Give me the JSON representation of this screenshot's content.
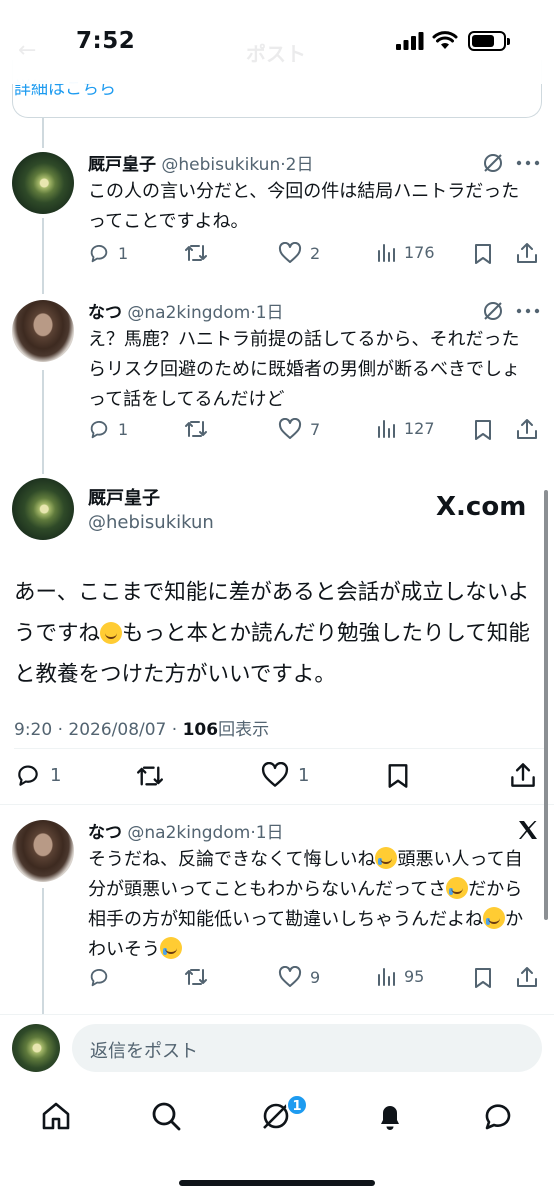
{
  "status": {
    "time": "7:52"
  },
  "header": {
    "title": "ポスト",
    "back": "←"
  },
  "prev_card": {
    "link": "詳細はこちら"
  },
  "replies": [
    {
      "name": "厩戸皇子",
      "handle": "@hebisukikun",
      "age": "2日",
      "text": "この人の言い分だと、今回の件は結局ハニトラだったってことですよね。",
      "replies": "1",
      "reposts": "",
      "likes": "2",
      "views": "176"
    },
    {
      "name": "なつ",
      "handle": "@na2kingdom",
      "age": "1日",
      "text": "え？馬鹿？ハニトラ前提の話してるから、それだったらリスク回避のために既婚者の男側が断るべきでしょって話をしてるんだけど",
      "replies": "1",
      "reposts": "",
      "likes": "7",
      "views": "127"
    }
  ],
  "main": {
    "name": "厩戸皇子",
    "handle": "@hebisukikun",
    "source": "X.com",
    "text_a": "あー、ここまで知能に差があると会話が成立しないようですね",
    "text_b": "もっと本とか読んだり勉強したりして知能と教養をつけた方がいいですよ。",
    "timestamp": "9:20 · 2026/08/07 · ",
    "views_count": "106",
    "views_label": "回表示",
    "replies": "1",
    "likes": "1"
  },
  "reply3": {
    "name": "なつ",
    "handle": "@na2kingdom",
    "age": "1日",
    "text_a": "そうだね、反論できなくて悔しいね",
    "text_b": "頭悪い人って自分が頭悪いってこともわからないんだってさ",
    "text_c": "だから相手の方が知能低いって勘違いしちゃうんだよね",
    "text_d": "かわいそう",
    "likes": "9",
    "views": "95"
  },
  "composer": {
    "placeholder": "返信をポスト"
  },
  "tabs": {
    "notif_badge": "1"
  },
  "colors": {
    "accent": "#1d9bf0",
    "text": "#0f1419",
    "muted": "#536471"
  }
}
